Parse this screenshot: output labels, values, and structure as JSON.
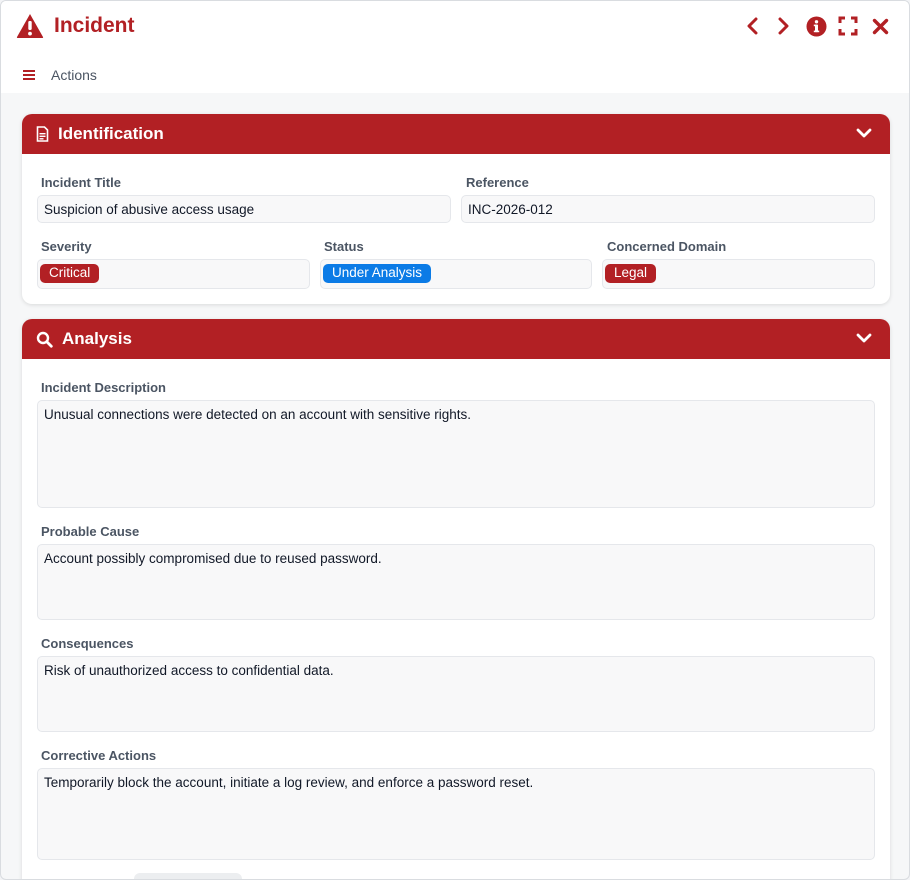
{
  "window": {
    "title": "Incident",
    "menu_label": "Actions"
  },
  "colors": {
    "brand": "#b22024",
    "status_blue": "#0b7be6",
    "badge_red": "#b22024"
  },
  "identification": {
    "header": "Identification",
    "incident_title_label": "Incident Title",
    "incident_title_value": "Suspicion of abusive access usage",
    "reference_label": "Reference",
    "reference_value": "INC-2026-012",
    "severity_label": "Severity",
    "severity_value": "Critical",
    "status_label": "Status",
    "status_value": "Under Analysis",
    "domain_label": "Concerned Domain",
    "domain_value": "Legal"
  },
  "analysis": {
    "header": "Analysis",
    "description_label": "Incident Description",
    "description_value": "Unusual connections were detected on an account with sensitive rights.",
    "cause_label": "Probable Cause",
    "cause_value": "Account possibly compromised due to reused password.",
    "consequences_label": "Consequences",
    "consequences_value": "Risk of unauthorized access to confidential data.",
    "corrective_label": "Corrective Actions",
    "corrective_value": "Temporarily block the account, initiate a log review, and enforce a password reset."
  }
}
